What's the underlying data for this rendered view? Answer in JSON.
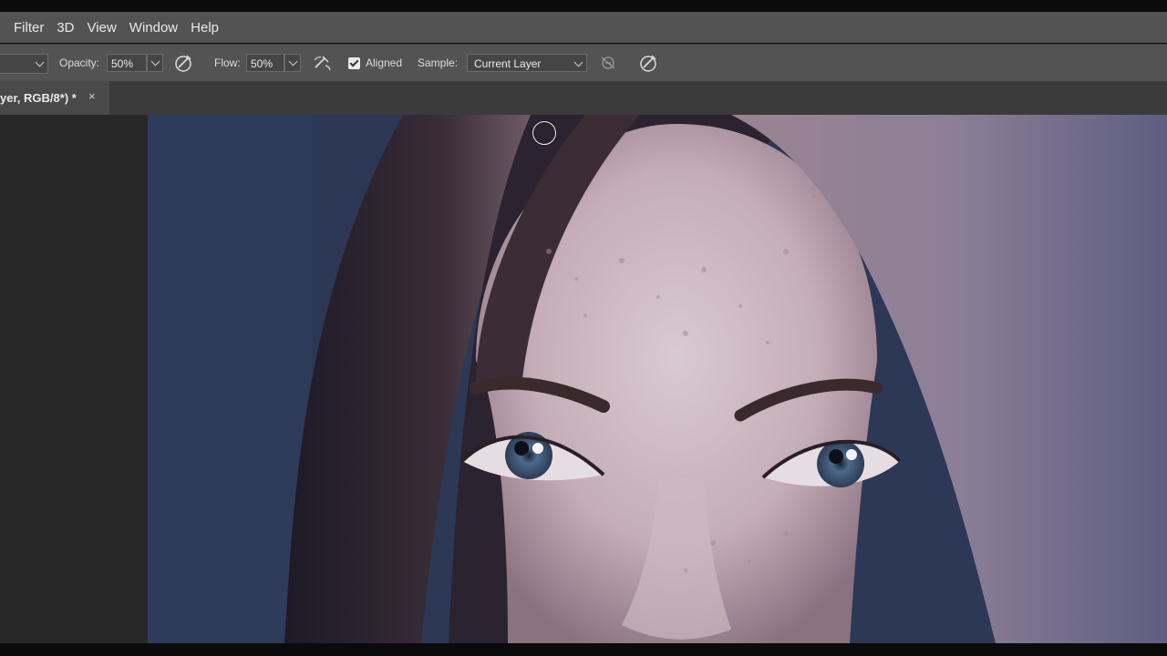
{
  "menu": {
    "items": [
      "Filter",
      "3D",
      "View",
      "Window",
      "Help"
    ]
  },
  "options": {
    "opacity_label": "Opacity:",
    "opacity_value": "50%",
    "flow_label": "Flow:",
    "flow_value": "50%",
    "aligned_label": "Aligned",
    "aligned_checked": true,
    "sample_label": "Sample:",
    "sample_value": "Current Layer"
  },
  "document_tab": {
    "label": "yer, RGB/8*) *",
    "close": "×"
  },
  "colors": {
    "menubar_bg": "#535353",
    "workspace_bg": "#282828",
    "tabbar_bg": "#3b3b3b"
  },
  "icons": [
    "brush-pressure-opacity-icon",
    "airbrush-icon",
    "ignore-adjustment-layers-icon",
    "brush-pressure-size-icon",
    "chevron-down-icon",
    "close-icon",
    "checkbox-icon",
    "brush-cursor-icon"
  ]
}
